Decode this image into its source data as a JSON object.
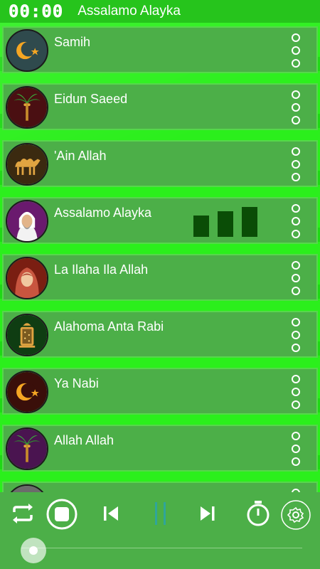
{
  "header": {
    "timer": "00:00",
    "now_playing": "Assalamo Alayka"
  },
  "tracks": [
    {
      "title": "Samih",
      "icon": "crescent-star-icon"
    },
    {
      "title": "Eidun Saeed",
      "icon": "palm-tree-icon"
    },
    {
      "title": "'Ain Allah",
      "icon": "camel-icon"
    },
    {
      "title": "Assalamo Alayka",
      "icon": "sheikh-portrait-icon",
      "playing": true
    },
    {
      "title": "La Ilaha Ila Allah",
      "icon": "hijab-woman-icon"
    },
    {
      "title": "Alahoma Anta Rabi",
      "icon": "lantern-icon"
    },
    {
      "title": "Ya Nabi",
      "icon": "crescent-star-icon"
    },
    {
      "title": "Allah Allah",
      "icon": "palm-tree-icon"
    },
    {
      "title": "",
      "icon": "partial-item-icon"
    }
  ],
  "player": {
    "controls": [
      "repeat-icon",
      "stop-icon",
      "previous-icon",
      "pause-icon",
      "next-icon",
      "timer-icon",
      "settings-icon"
    ],
    "progress": 0
  },
  "colors": {
    "background": "#27e619",
    "row": "#4caf48",
    "eq_bars": "#0a4d06"
  }
}
